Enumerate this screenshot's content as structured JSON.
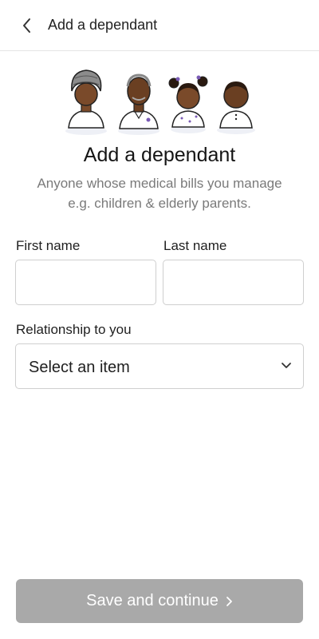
{
  "header": {
    "title": "Add a dependant"
  },
  "hero": {
    "title": "Add a dependant",
    "subtitle": "Anyone whose medical bills you manage e.g. children & elderly parents."
  },
  "form": {
    "first_name": {
      "label": "First name",
      "value": "",
      "placeholder": ""
    },
    "last_name": {
      "label": "Last name",
      "value": "",
      "placeholder": ""
    },
    "relationship": {
      "label": "Relationship to you",
      "selected": "Select an item"
    }
  },
  "footer": {
    "cta_label": "Save and continue"
  },
  "colors": {
    "cta_disabled": "#a9a9a9",
    "border": "#cfcfcf"
  }
}
